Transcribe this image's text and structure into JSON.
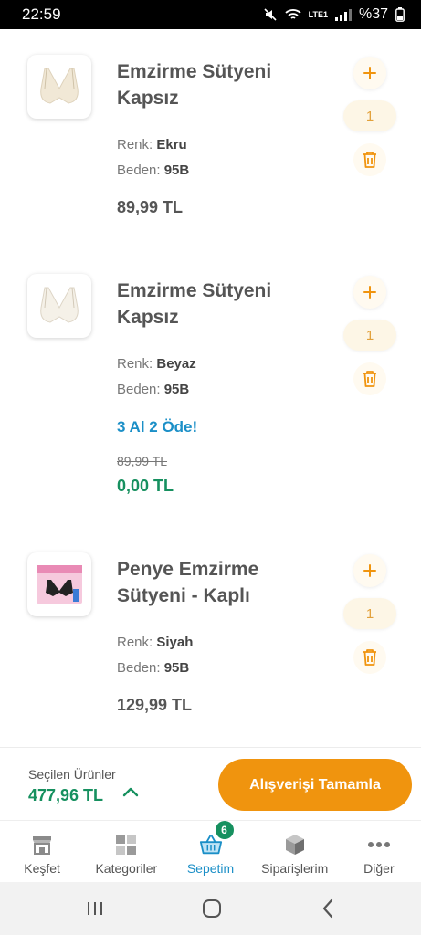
{
  "status_bar": {
    "time": "22:59",
    "battery": "%37",
    "network": "LTE1"
  },
  "cart": {
    "items": [
      {
        "title": "Emzirme Sütyeni Kapsız",
        "color_label": "Renk:",
        "color": "Ekru",
        "size_label": "Beden:",
        "size": "95B",
        "price": "89,99 TL",
        "quantity": "1"
      },
      {
        "title": "Emzirme Sütyeni Kapsız",
        "color_label": "Renk:",
        "color": "Beyaz",
        "size_label": "Beden:",
        "size": "95B",
        "promo": "3 Al 2 Öde!",
        "old_price": "89,99 TL",
        "price": "0,00 TL",
        "quantity": "1"
      },
      {
        "title": "Penye Emzirme Sütyeni - Kaplı",
        "color_label": "Renk:",
        "color": "Siyah",
        "size_label": "Beden:",
        "size": "95B",
        "price": "129,99 TL",
        "quantity": "1"
      }
    ]
  },
  "summary": {
    "label": "Seçilen Ürünler",
    "total": "477,96 TL",
    "checkout_label": "Alışverişi Tamamla"
  },
  "tabs": [
    {
      "label": "Keşfet",
      "icon": "store-icon"
    },
    {
      "label": "Kategoriler",
      "icon": "grid-icon"
    },
    {
      "label": "Sepetim",
      "icon": "basket-icon",
      "badge": "6",
      "active": true
    },
    {
      "label": "Siparişlerim",
      "icon": "box-icon"
    },
    {
      "label": "Diğer",
      "icon": "more-icon"
    }
  ],
  "colors": {
    "accent": "#f0940e",
    "green": "#16905f",
    "blue": "#1b8fc7"
  }
}
